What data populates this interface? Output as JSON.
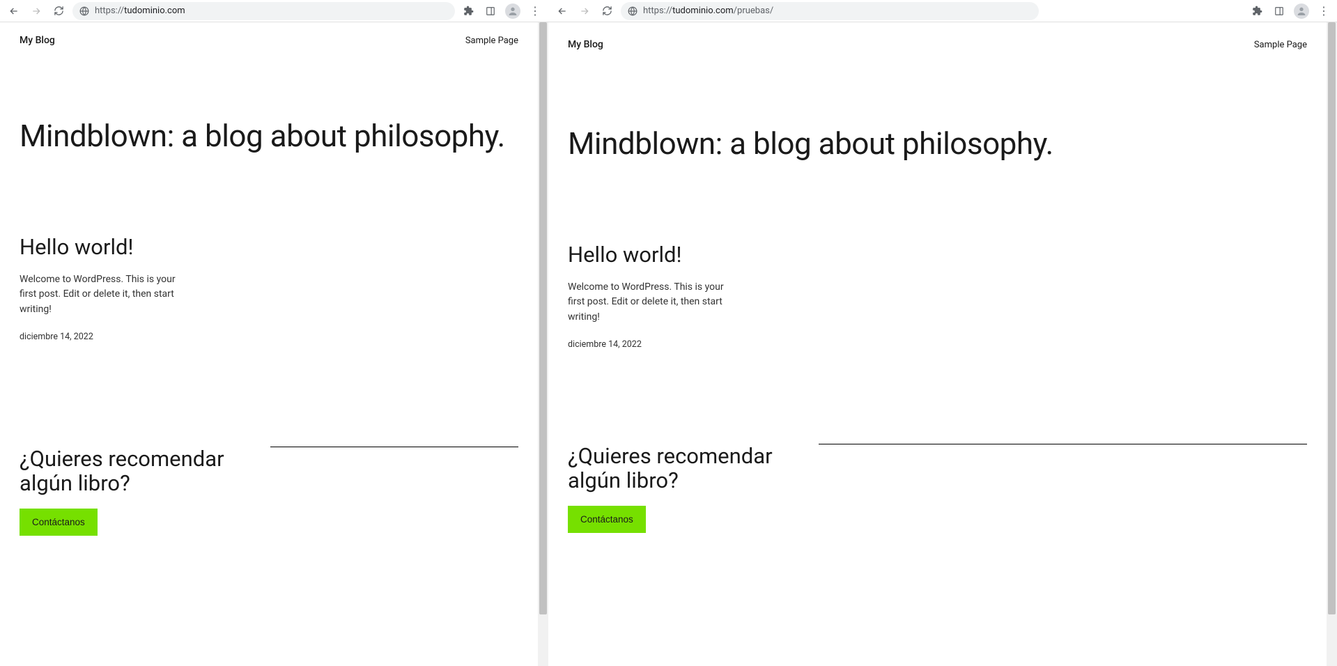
{
  "windows": [
    {
      "url_prefix": "https://",
      "url_host": "tudominio.com",
      "url_path": "",
      "site_title": "My Blog",
      "nav_link": "Sample Page",
      "hero": "Mindblown: a blog about philosophy.",
      "post_title": "Hello world!",
      "post_excerpt": "Welcome to WordPress. This is your first post. Edit or delete it, then start writing!",
      "post_date": "diciembre 14, 2022",
      "cta_heading": "¿Quieres recomendar algún libro?",
      "cta_button": "Contáctanos"
    },
    {
      "url_prefix": "https://",
      "url_host": "tudominio.com",
      "url_path": "/pruebas/",
      "site_title": "My Blog",
      "nav_link": "Sample Page",
      "hero": "Mindblown: a blog about philosophy.",
      "post_title": "Hello world!",
      "post_excerpt": "Welcome to WordPress. This is your first post. Edit or delete it, then start writing!",
      "post_date": "diciembre 14, 2022",
      "cta_heading": "¿Quieres recomendar algún libro?",
      "cta_button": "Contáctanos"
    }
  ]
}
